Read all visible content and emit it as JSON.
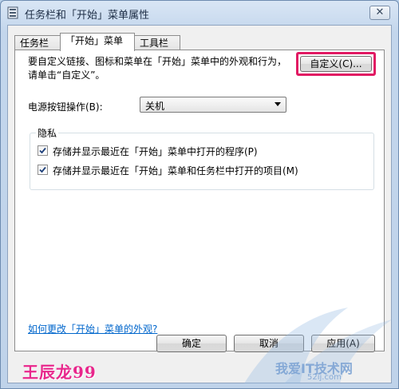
{
  "window": {
    "title": "任务栏和「开始」菜单属性",
    "close_glyph": "✕"
  },
  "tabs": [
    {
      "label": "任务栏",
      "active": false
    },
    {
      "label": "「开始」菜单",
      "active": true
    },
    {
      "label": "工具栏",
      "active": false
    }
  ],
  "start_menu": {
    "description": "要自定义链接、图标和菜单在「开始」菜单中的外观和行为，请单击“自定义”。",
    "customize_button": "自定义(C)...",
    "power_label": "电源按钮操作(B):",
    "power_value": "关机",
    "privacy_legend": "隐私",
    "checkboxes": [
      {
        "label": "存储并显示最近在「开始」菜单中打开的程序(P)",
        "checked": true
      },
      {
        "label": "存储并显示最近在「开始」菜单和任务栏中打开的项目(M)",
        "checked": true
      }
    ],
    "help_link": "如何更改「开始」菜单的外观?"
  },
  "footer": {
    "ok": "确定",
    "cancel": "取消",
    "apply": "应用(A)"
  },
  "watermarks": {
    "left": "王辰龙99",
    "right": "我爱IT技术网",
    "right_sub": "52ij.com"
  },
  "colors": {
    "highlight": "#e11a63",
    "link": "#0066cc",
    "watermark_left": "#e8278c"
  },
  "icons": {
    "app": "taskbar-properties-icon",
    "close": "close-icon",
    "dropdown": "chevron-down-icon",
    "check": "checkmark-icon"
  }
}
